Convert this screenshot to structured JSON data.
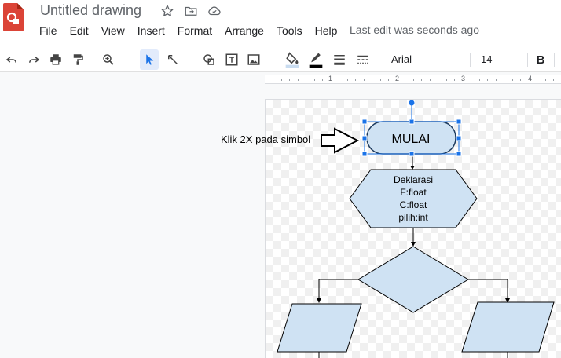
{
  "header": {
    "title": "Untitled drawing",
    "last_edit": "Last edit was seconds ago",
    "icons": [
      "star-icon",
      "move-to-folder-icon",
      "cloud-status-icon"
    ]
  },
  "menu": [
    "File",
    "Edit",
    "View",
    "Insert",
    "Format",
    "Arrange",
    "Tools",
    "Help"
  ],
  "toolbar": {
    "font": "Arial",
    "font_size": "14",
    "bold_label": "B",
    "fill_color": "#c9dcf0",
    "line_color": "#000000"
  },
  "ruler": {
    "labels": [
      "1",
      "2",
      "3",
      "4"
    ]
  },
  "annotation": {
    "text": "Klik 2X pada simbol"
  },
  "flowchart": {
    "start_label": "MULAI",
    "declaration_lines": [
      "Deklarasi",
      "F:float",
      "C:float",
      "pilih:int"
    ],
    "shape_fill": "#cfe2f3",
    "selection_color": "#1a73e8"
  }
}
